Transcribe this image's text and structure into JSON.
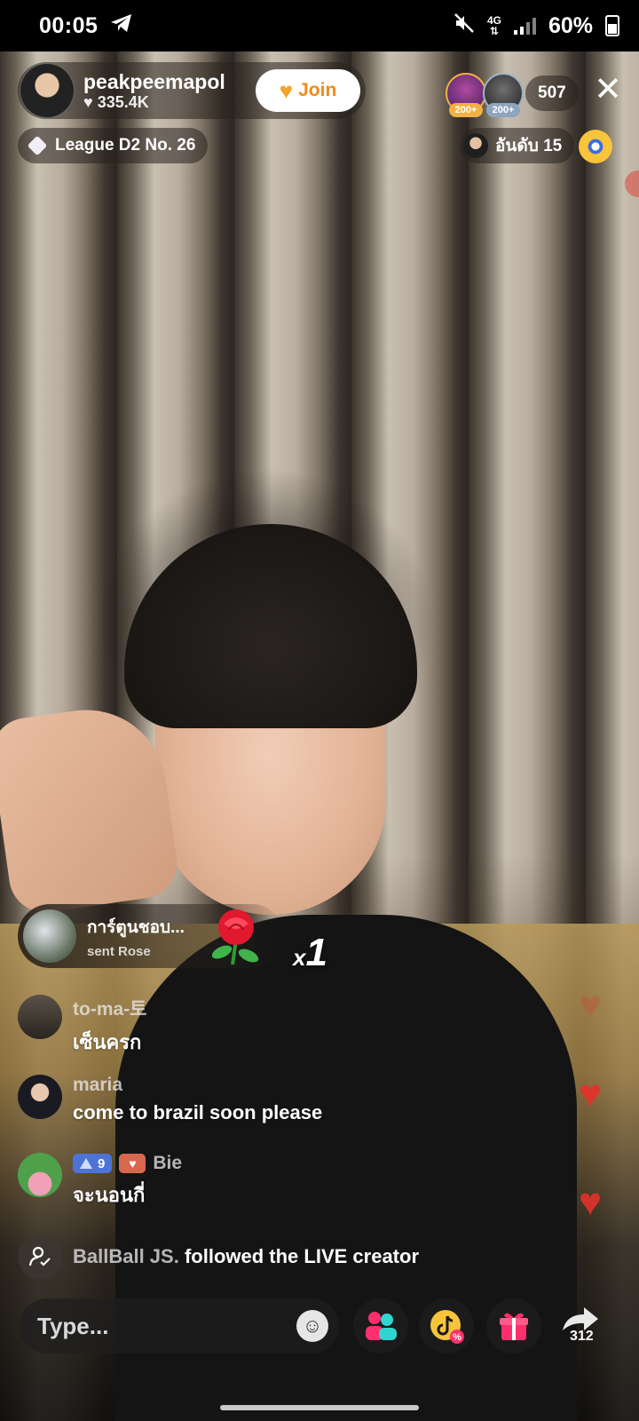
{
  "status_bar": {
    "time": "00:05",
    "network": "4G",
    "battery": "60%",
    "icons": [
      "telegram-icon",
      "mute-icon",
      "signal-icon",
      "battery-icon"
    ]
  },
  "host": {
    "name": "peakpeemapol",
    "likes": "335.4K",
    "join_label": "Join"
  },
  "viewers": {
    "badges": [
      "200+",
      "200+"
    ],
    "count": "507"
  },
  "league": {
    "label": "League D2 No. 26"
  },
  "rank": {
    "label": "อันดับ 15"
  },
  "gift": {
    "sender": "การ์ตูนชอบ...",
    "action": "sent Rose",
    "multiplier_prefix": "x",
    "multiplier": "1"
  },
  "comments": [
    {
      "user": "to-ma-토",
      "text": "เซ็นครก"
    },
    {
      "user": "maria",
      "text": "come to brazil soon please"
    },
    {
      "user": "Bie",
      "level": "9",
      "text": "จะนอนกี่"
    }
  ],
  "follow_event": {
    "user": "BallBall JS.",
    "text": "followed the LIVE creator"
  },
  "bottom_bar": {
    "input_placeholder": "Type...",
    "share_count": "312"
  },
  "colors": {
    "join_text": "#f08a1a",
    "heart": "#e2322c",
    "level_badge": "#4d73d6",
    "gift_pink": "#ff2f6d",
    "teal": "#2fd6d0"
  }
}
